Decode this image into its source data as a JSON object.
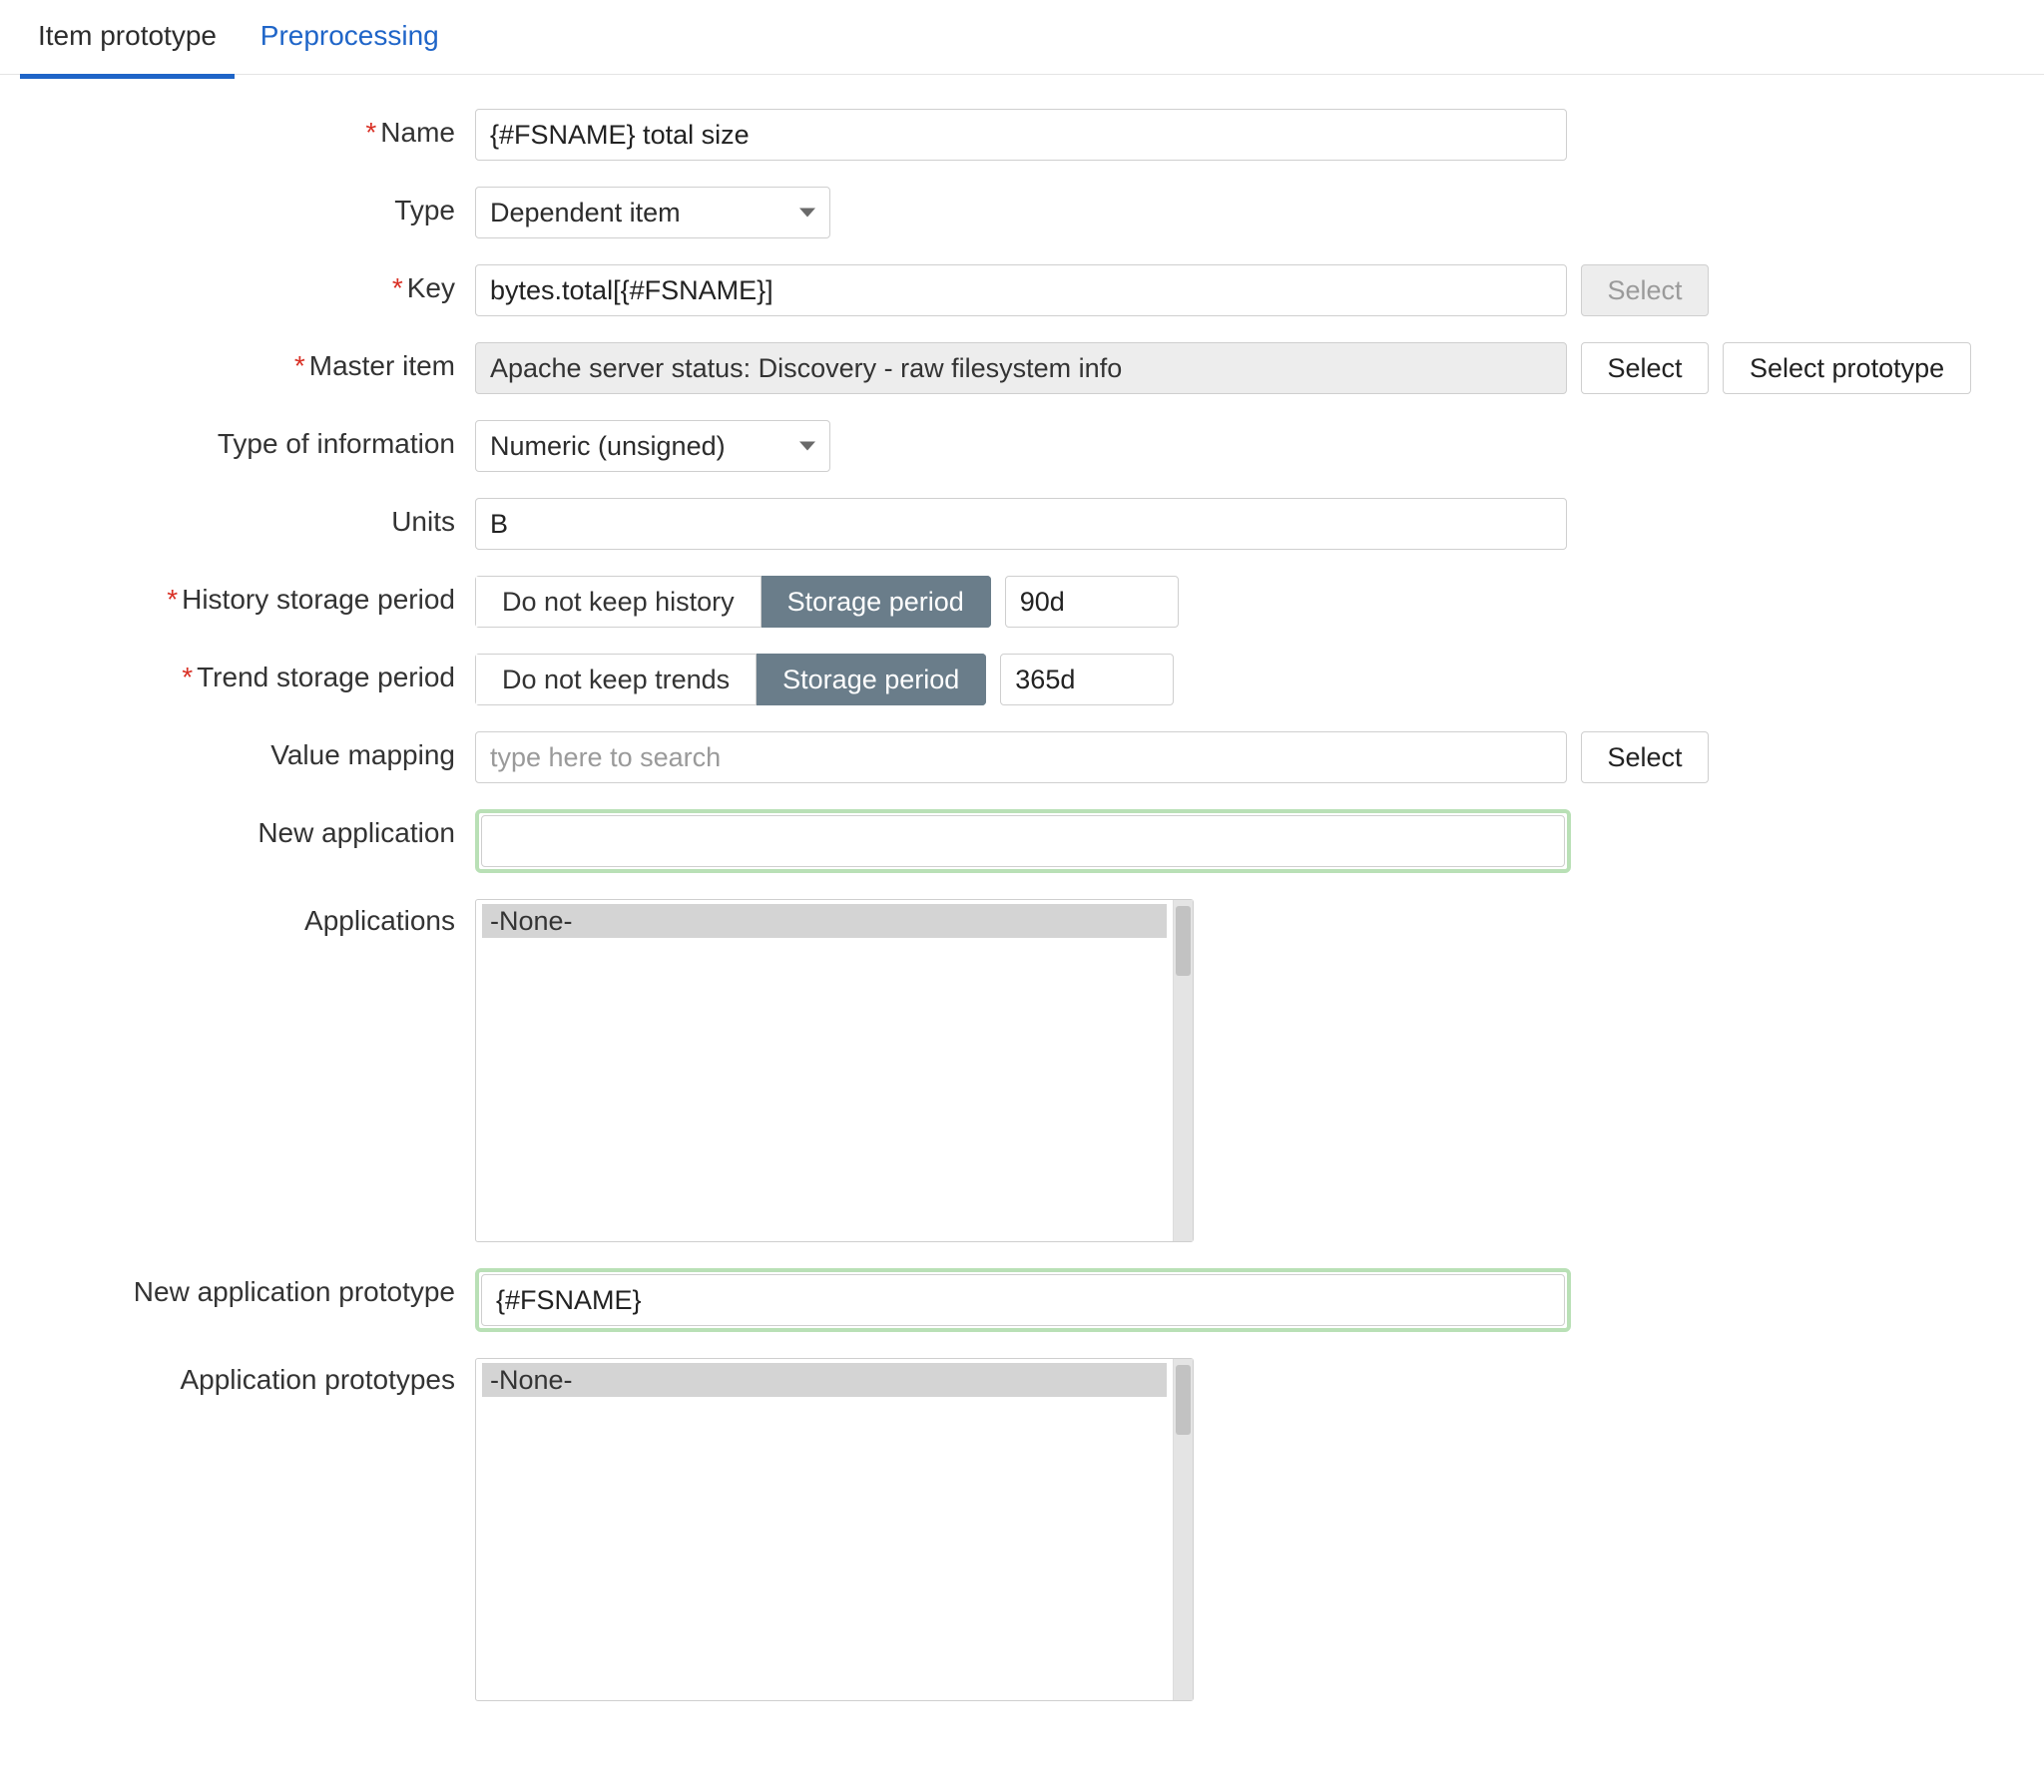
{
  "tabs": {
    "item_prototype": "Item prototype",
    "preprocessing": "Preprocessing"
  },
  "labels": {
    "name": "Name",
    "type": "Type",
    "key": "Key",
    "master_item": "Master item",
    "type_of_information": "Type of information",
    "units": "Units",
    "history_storage_period": "History storage period",
    "trend_storage_period": "Trend storage period",
    "value_mapping": "Value mapping",
    "new_application": "New application",
    "applications": "Applications",
    "new_application_prototype": "New application prototype",
    "application_prototypes": "Application prototypes"
  },
  "values": {
    "name": "{#FSNAME} total size",
    "type": "Dependent item",
    "key": "bytes.total[{#FSNAME}]",
    "master_item": "Apache server status: Discovery - raw filesystem info",
    "type_of_information": "Numeric (unsigned)",
    "units": "B",
    "history_value": "90d",
    "trend_value": "365d",
    "value_mapping_placeholder": "type here to search",
    "new_application": "",
    "new_application_prototype": "{#FSNAME}"
  },
  "buttons": {
    "select": "Select",
    "select_prototype": "Select prototype"
  },
  "segments": {
    "do_not_keep_history": "Do not keep history",
    "do_not_keep_trends": "Do not keep trends",
    "storage_period": "Storage period"
  },
  "lists": {
    "applications_none": "-None-",
    "application_prototypes_none": "-None-"
  }
}
